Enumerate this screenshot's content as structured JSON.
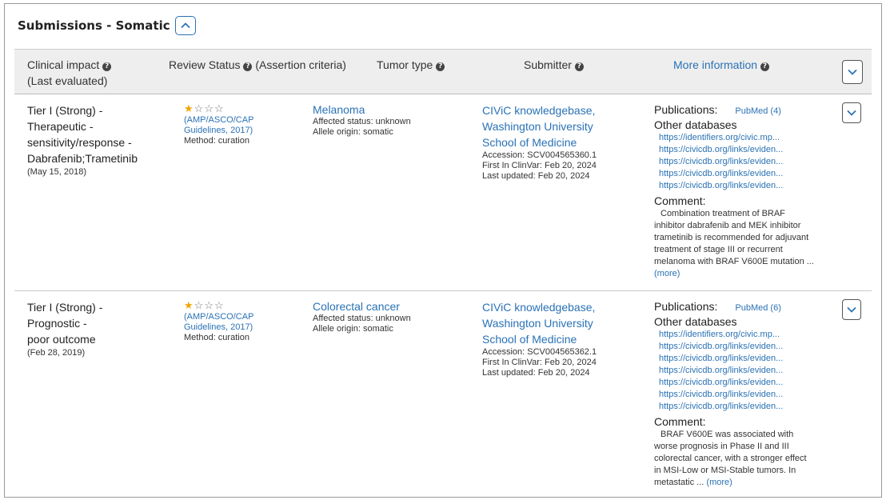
{
  "section": {
    "title": "Submissions - Somatic"
  },
  "header": {
    "clinical_impact": "Clinical impact",
    "last_evaluated": "(Last evaluated)",
    "review_status": "Review Status",
    "assertion_criteria": "(Assertion criteria)",
    "tumor_type": "Tumor type",
    "submitter": "Submitter",
    "more_information": "More information",
    "help_glyph": "?"
  },
  "rows": [
    {
      "impact": [
        "Tier I (Strong) -",
        "Therapeutic -",
        "sensitivity/response -",
        "Dabrafenib;Trametinib"
      ],
      "date": "(May 15, 2018)",
      "stars_filled": 1,
      "stars_total": 4,
      "criteria": [
        "(AMP/ASCO/CAP",
        "Guidelines, 2017)"
      ],
      "method": "Method: curation",
      "condition": "Melanoma",
      "affected": "Affected status: unknown",
      "allele": "Allele origin: somatic",
      "submitter": [
        "CIViC knowledgebase,",
        "Washington University",
        "School of Medicine"
      ],
      "accession": "Accession: SCV004565360.1",
      "first_in": "First In ClinVar: Feb 20, 2024",
      "updated": "Last updated: Feb 20, 2024",
      "publications_label": "Publications:",
      "pubmed": "PubMed (4)",
      "other_db_label": "Other databases",
      "db_links": [
        "https://identifiers.org/civic.mp...",
        "https://civicdb.org/links/eviden...",
        "https://civicdb.org/links/eviden...",
        "https://civicdb.org/links/eviden...",
        "https://civicdb.org/links/eviden..."
      ],
      "comment_label": "Comment:",
      "comment_lines": [
        "Combination treatment of BRAF",
        "inhibitor dabrafenib and MEK inhibitor",
        "trametinib is recommended for adjuvant",
        "treatment of stage III or recurrent",
        "melanoma with BRAF V600E mutation ..."
      ],
      "comment_more_prefix": "",
      "more": "(more)"
    },
    {
      "impact": [
        "Tier I (Strong) -",
        "Prognostic -",
        "poor outcome"
      ],
      "date": "(Feb 28, 2019)",
      "stars_filled": 1,
      "stars_total": 4,
      "criteria": [
        "(AMP/ASCO/CAP",
        "Guidelines, 2017)"
      ],
      "method": "Method: curation",
      "condition": "Colorectal cancer",
      "affected": "Affected status: unknown",
      "allele": "Allele origin: somatic",
      "submitter": [
        "CIViC knowledgebase,",
        "Washington University",
        "School of Medicine"
      ],
      "accession": "Accession: SCV004565362.1",
      "first_in": "First In ClinVar: Feb 20, 2024",
      "updated": "Last updated: Feb 20, 2024",
      "publications_label": "Publications:",
      "pubmed": "PubMed (6)",
      "other_db_label": "Other databases",
      "db_links": [
        "https://identifiers.org/civic.mp...",
        "https://civicdb.org/links/eviden...",
        "https://civicdb.org/links/eviden...",
        "https://civicdb.org/links/eviden...",
        "https://civicdb.org/links/eviden...",
        "https://civicdb.org/links/eviden...",
        "https://civicdb.org/links/eviden..."
      ],
      "comment_label": "Comment:",
      "comment_lines": [
        "BRAF V600E was associated with",
        "worse prognosis in Phase II and III",
        "colorectal cancer, with a stronger effect",
        "in MSI-Low or MSI-Stable tumors. In"
      ],
      "comment_more_prefix": "metastatic ... ",
      "more": "(more)"
    }
  ],
  "icons": {
    "collapse": "chevron-up-icon",
    "expand": "chevron-down-icon",
    "help": "question-circle-icon",
    "star_filled": "star-filled-icon",
    "star_empty": "star-outline-icon"
  },
  "colors": {
    "link": "#2a72b5",
    "star": "#f0a500",
    "header_bg": "#eeeeee"
  }
}
